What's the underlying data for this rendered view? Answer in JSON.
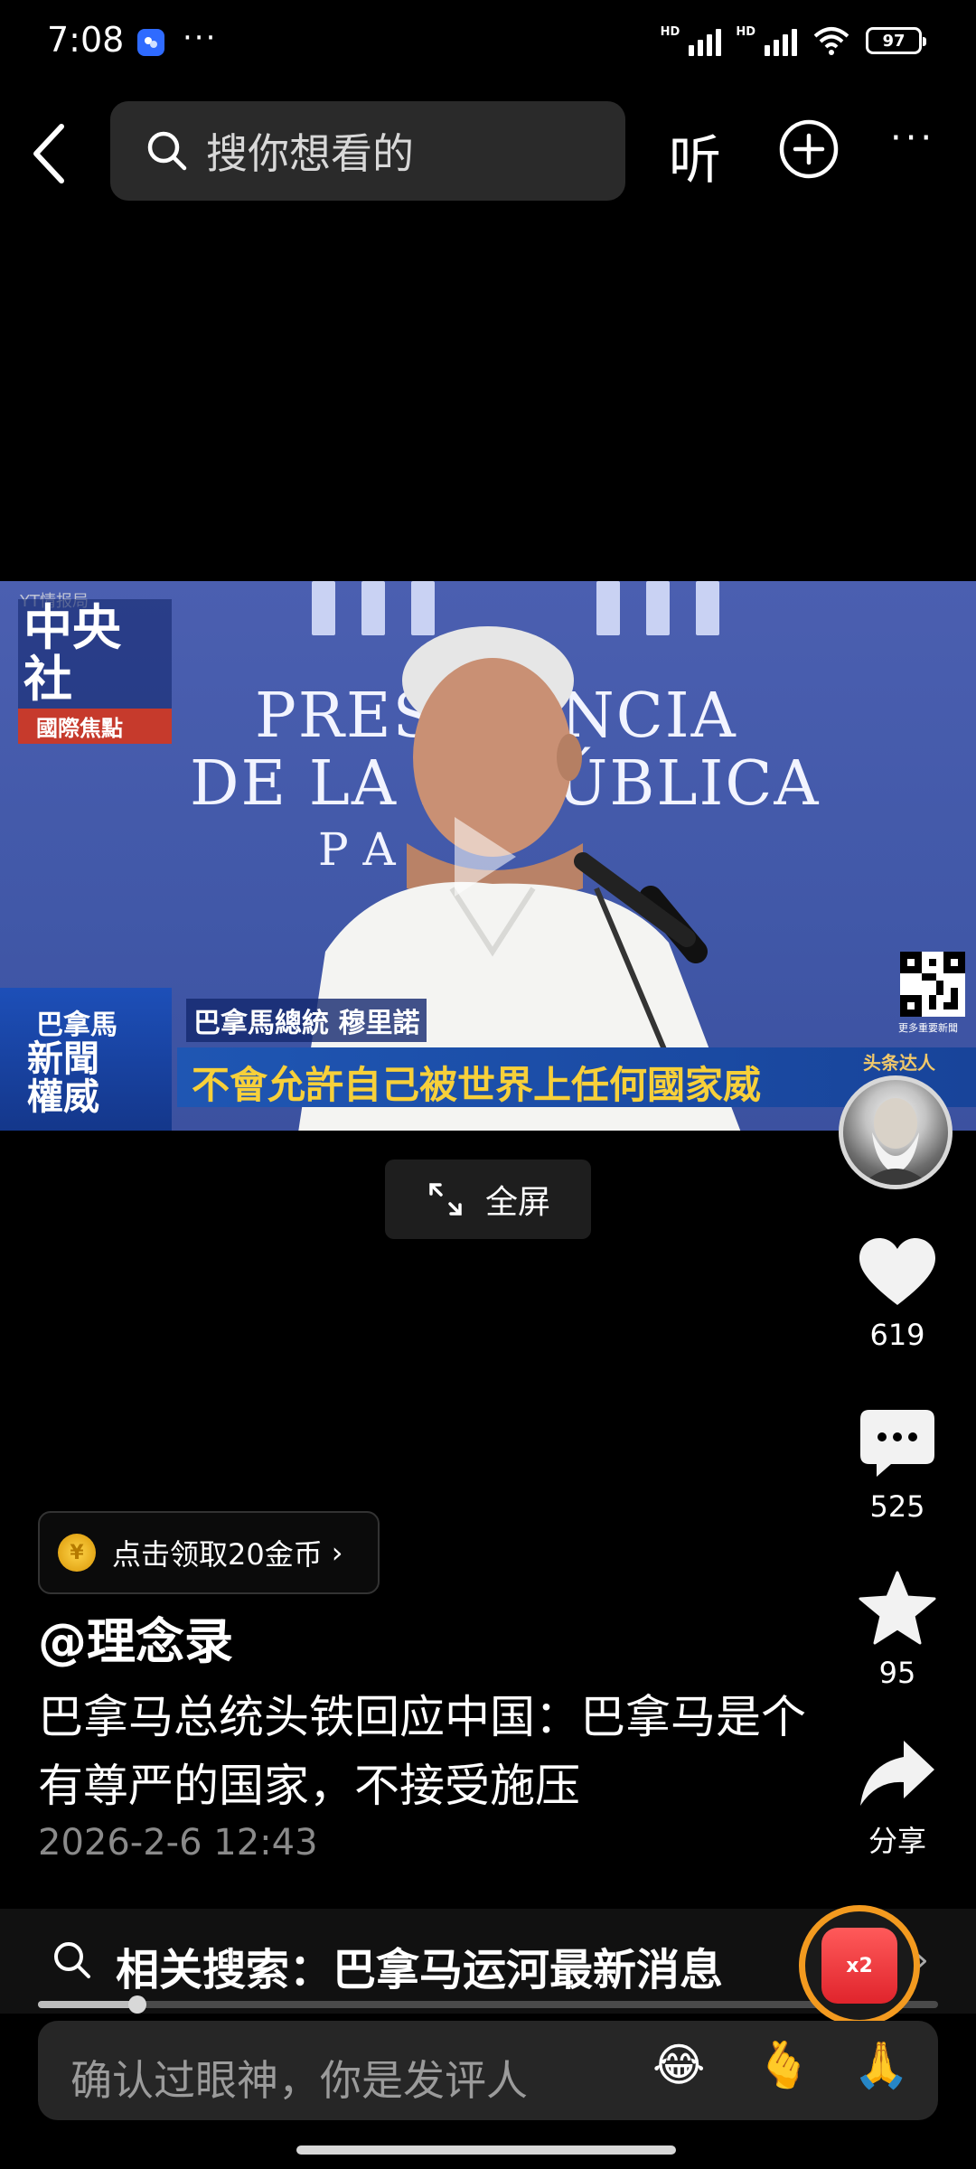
{
  "status_bar": {
    "time": "7:08",
    "dots": "···",
    "hd_labels": [
      "HD",
      "HD"
    ],
    "battery": "97"
  },
  "top_bar": {
    "search_placeholder": "搜你想看的",
    "listen_label": "听",
    "more_label": "···"
  },
  "video": {
    "source_tag": "YT情报局",
    "logo_main": "中央社",
    "logo_sub": "國際焦點",
    "backdrop_line1": "PRESIDENCIA",
    "backdrop_line2": "DE LA REPÚBLICA",
    "backdrop_line3": "P A",
    "qr_caption": "更多重要新聞",
    "lower_third_country": "巴拿馬",
    "lower_third_badge_1": "新聞",
    "lower_third_badge_2": "權威",
    "speaker_name": "巴拿馬總統 穆里諾",
    "subtitle": "不會允許自己被世界上任何國家威",
    "watermark": "头条达人"
  },
  "fullscreen_label": "全屏",
  "actions": {
    "like_count": "619",
    "comment_count": "525",
    "favorite_count": "95",
    "share_label": "分享"
  },
  "coin_prompt": "点击领取20金币",
  "author": "@理念录",
  "description": "巴拿马总统头铁回应中国：巴拿马是个有尊严的国家，不接受施压",
  "date": "2026-2-6 12:43",
  "related_search": "相关搜索：巴拿马运河最新消息",
  "playback_progress": 0.11,
  "redpacket_label": "x2",
  "comment_placeholder": "确认过眼神，你是发评人",
  "emojis": [
    "😂",
    "🫰",
    "🙏"
  ],
  "colors": {
    "background": "#000000",
    "accent_orange": "#f39a1f",
    "subtitle_yellow": "#f7d03a"
  }
}
